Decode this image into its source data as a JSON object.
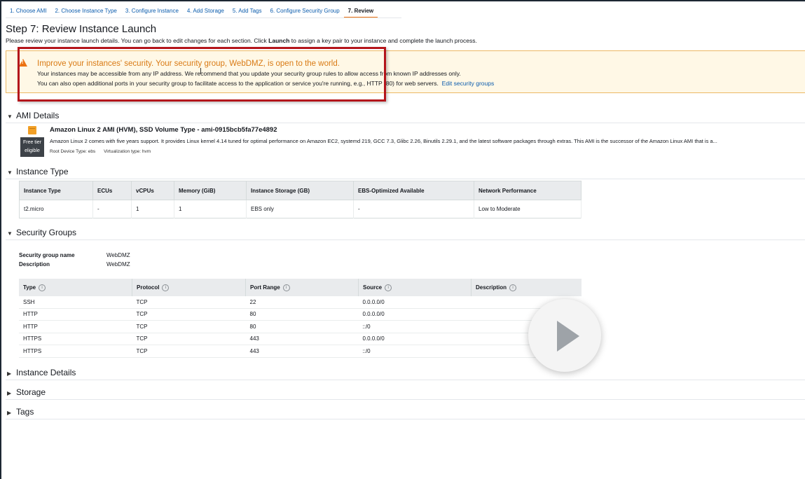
{
  "tabs": [
    {
      "label": "1. Choose AMI"
    },
    {
      "label": "2. Choose Instance Type"
    },
    {
      "label": "3. Configure Instance"
    },
    {
      "label": "4. Add Storage"
    },
    {
      "label": "5. Add Tags"
    },
    {
      "label": "6. Configure Security Group"
    },
    {
      "label": "7. Review"
    }
  ],
  "page_title": "Step 7: Review Instance Launch",
  "intro": {
    "before": "Please review your instance launch details. You can go back to edit changes for each section. Click ",
    "bold": "Launch",
    "after": " to assign a key pair to your instance and complete the launch process."
  },
  "warning": {
    "icon": "warning-triangle-icon",
    "title": "Improve your instances' security. Your security group, WebDMZ, is open to the world.",
    "line1": "Your instances may be accessible from any IP address. We recommend that you update your security group rules to allow access from known IP addresses only.",
    "line2": "You can also open additional ports in your security group to facilitate access to the application or service you're running, e.g., HTTP (80) for web servers.",
    "link": "Edit security groups"
  },
  "sections": {
    "ami": "AMI Details",
    "instance_type": "Instance Type",
    "security_groups": "Security Groups",
    "instance_details": "Instance Details",
    "storage": "Storage",
    "tags": "Tags"
  },
  "ami": {
    "badge": [
      "Free tier",
      "eligible"
    ],
    "name": "Amazon Linux 2 AMI (HVM), SSD Volume Type - ami-0915bcb5fa77e4892",
    "description": "Amazon Linux 2 comes with five years support. It provides Linux kernel 4.14 tuned for optimal performance on Amazon EC2, systemd 219, GCC 7.3, Glibc 2.26, Binutils 2.29.1, and the latest software packages through extras. This AMI is the successor of the Amazon Linux AMI that is a...",
    "root_device": "Root Device Type: ebs",
    "virtualization": "Virtualization type: hvm"
  },
  "instance_type_table": {
    "headers": [
      "Instance Type",
      "ECUs",
      "vCPUs",
      "Memory (GiB)",
      "Instance Storage (GB)",
      "EBS-Optimized Available",
      "Network Performance"
    ],
    "rows": [
      [
        "t2.micro",
        "-",
        "1",
        "1",
        "EBS only",
        "-",
        "Low to Moderate"
      ]
    ]
  },
  "security_group": {
    "name_label": "Security group name",
    "name_value": "WebDMZ",
    "desc_label": "Description",
    "desc_value": "WebDMZ"
  },
  "rules_table": {
    "headers": [
      "Type",
      "Protocol",
      "Port Range",
      "Source",
      "Description"
    ],
    "rows": [
      [
        "SSH",
        "TCP",
        "22",
        "0.0.0.0/0",
        ""
      ],
      [
        "HTTP",
        "TCP",
        "80",
        "0.0.0.0/0",
        ""
      ],
      [
        "HTTP",
        "TCP",
        "80",
        "::/0",
        ""
      ],
      [
        "HTTPS",
        "TCP",
        "443",
        "0.0.0.0/0",
        ""
      ],
      [
        "HTTPS",
        "TCP",
        "443",
        "::/0",
        ""
      ]
    ]
  },
  "colors": {
    "link": "#0b5cad",
    "active_tab": "#ec7211",
    "warning_text": "#d97a14",
    "warning_bg": "#fff8e6",
    "highlight_box": "#b4151b"
  }
}
